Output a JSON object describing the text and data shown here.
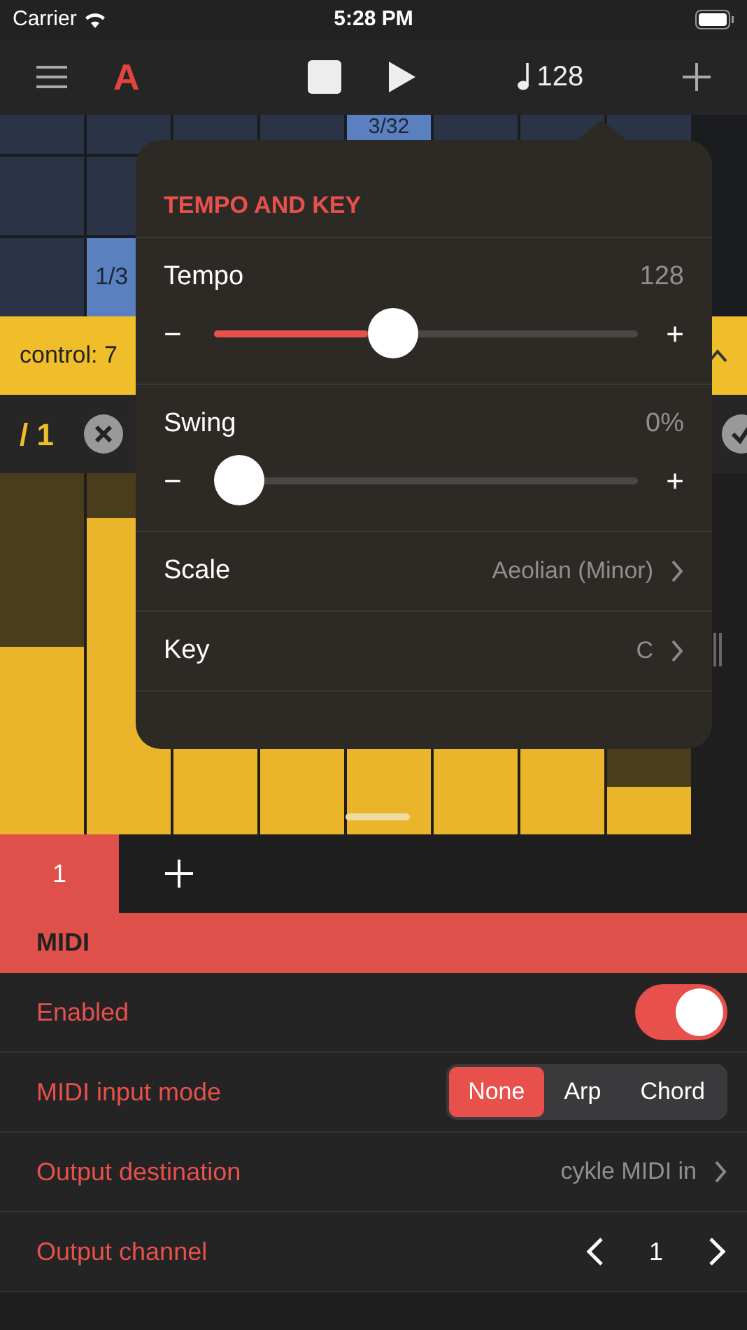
{
  "status_bar": {
    "carrier": "Carrier",
    "time": "5:28 PM"
  },
  "toolbar": {
    "logo": "A",
    "tempo": "128"
  },
  "grid": {
    "notes": [
      {
        "label": "3/32"
      },
      {
        "label": "1/3"
      }
    ]
  },
  "control_bar": {
    "label": "control: 7"
  },
  "lane": {
    "label": "/ 1"
  },
  "bars": [
    {
      "level": 0.52
    },
    {
      "level": 0.875
    },
    {
      "level": 0.3
    },
    {
      "level": 0.3
    },
    {
      "level": 0.3
    },
    {
      "level": 0.3
    },
    {
      "level": 0.3
    },
    {
      "level": 0.13
    }
  ],
  "popover": {
    "title": "TEMPO AND KEY",
    "sliders": [
      {
        "label": "Tempo",
        "reading": "128",
        "level": 0.41,
        "minus": "−",
        "plus": "+"
      },
      {
        "label": "Swing",
        "reading": "0%",
        "level": 0,
        "minus": "−",
        "plus": "+"
      }
    ],
    "rows": [
      {
        "label": "Scale",
        "value": "Aeolian (Minor)"
      },
      {
        "label": "Key",
        "value": "C"
      }
    ]
  },
  "tabs": [
    {
      "label": "1",
      "selected": true
    }
  ],
  "midi": {
    "title": "MIDI",
    "rows": [
      {
        "kind": "toggle",
        "label": "Enabled",
        "on": true
      },
      {
        "kind": "segments",
        "label": "MIDI input mode",
        "options": [
          {
            "label": "None",
            "selected": true
          },
          {
            "label": "Arp",
            "selected": false
          },
          {
            "label": "Chord",
            "selected": false
          }
        ]
      },
      {
        "kind": "link",
        "label": "Output destination",
        "value": "cykle MIDI in"
      },
      {
        "kind": "stepper",
        "label": "Output channel",
        "value": "1"
      }
    ]
  }
}
